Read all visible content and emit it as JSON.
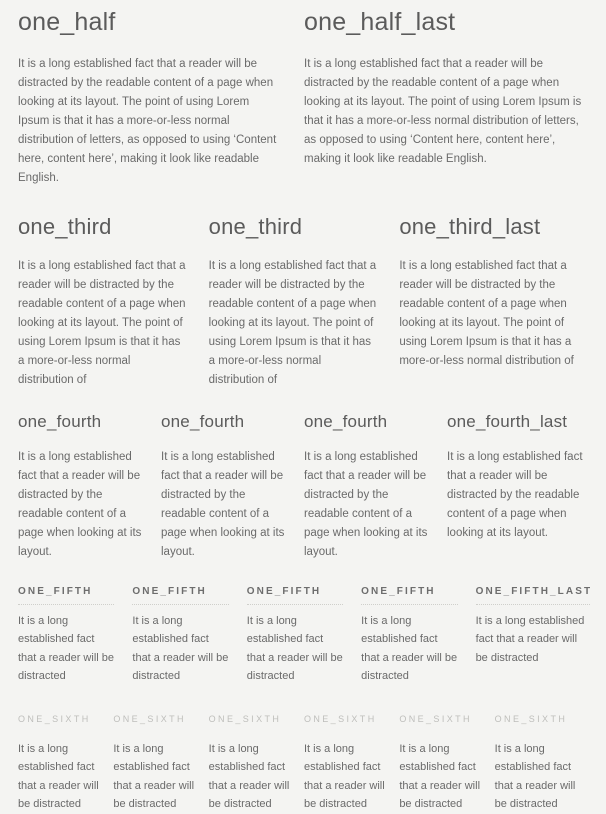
{
  "page": {
    "background_color": "#f4f4f2",
    "heading_color": "#5b5b5b",
    "body_text_color": "#6a6a6a",
    "muted_heading_color": "#bebebb",
    "divider_color": "#cfcfcb"
  },
  "rows": [
    {
      "name": "one_half",
      "columns": [
        {
          "heading": "one_half",
          "body": "It is a long established fact that a reader will be distracted by the readable content of a page when looking at its layout. The point of using Lorem Ipsum is that it has a more-or-less normal distribution of letters, as opposed to using ‘Content here, content here’, making it look like readable English."
        },
        {
          "heading": "one_half_last",
          "body": "It is a long established fact that a reader will be distracted by the readable content of a page when looking at its layout. The point of using Lorem Ipsum is that it has a more-or-less normal distribution of letters, as opposed to using ‘Content here, content here’, making it look like readable English."
        }
      ]
    },
    {
      "name": "one_third",
      "columns": [
        {
          "heading": "one_third",
          "body": "It is a long established fact that a reader will be distracted by the readable content of a page when looking at its layout. The point of using Lorem Ipsum is that it has a more-or-less normal distribution of"
        },
        {
          "heading": "one_third",
          "body": "It is a long established fact that a reader will be distracted by the readable content of a page when looking at its layout. The point of using Lorem Ipsum is that it has a more-or-less normal distribution of"
        },
        {
          "heading": "one_third_last",
          "body": "It is a long established fact that a reader will be distracted by the readable content of a page when looking at its layout. The point of using Lorem Ipsum is that it has a more-or-less normal distribution of"
        }
      ]
    },
    {
      "name": "one_fourth",
      "columns": [
        {
          "heading": "one_fourth",
          "body": "It is a long established fact that a reader will be distracted by the readable content of a page when looking at its layout."
        },
        {
          "heading": "one_fourth",
          "body": "It is a long established fact that a reader will be distracted by the readable content of a page when looking at its layout."
        },
        {
          "heading": "one_fourth",
          "body": "It is a long established fact that a reader will be distracted by the readable content of a page when looking at its layout."
        },
        {
          "heading": "one_fourth_last",
          "body": "It is a long established fact that a reader will be distracted by the readable content of a page when looking at its layout."
        }
      ]
    },
    {
      "name": "one_fifth",
      "columns": [
        {
          "heading": "ONE_FIFTH",
          "body": "It is a long established fact that a reader will be distracted"
        },
        {
          "heading": "ONE_FIFTH",
          "body": "It is a long established fact that a reader will be distracted"
        },
        {
          "heading": "ONE_FIFTH",
          "body": "It is a long established fact that a reader will be distracted"
        },
        {
          "heading": "ONE_FIFTH",
          "body": "It is a long established fact that a reader will be distracted"
        },
        {
          "heading": "ONE_FIFTH_LAST",
          "body": "It is a long established fact that a reader will be distracted"
        }
      ]
    },
    {
      "name": "one_sixth",
      "columns": [
        {
          "heading": "ONE_SIXTH",
          "body": "It is a long established fact that a reader will be distracted"
        },
        {
          "heading": "ONE_SIXTH",
          "body": "It is a long established fact that a reader will be distracted"
        },
        {
          "heading": "ONE_SIXTH",
          "body": "It is a long established fact that a reader will be distracted"
        },
        {
          "heading": "ONE_SIXTH",
          "body": "It is a long established fact that a reader will be distracted"
        },
        {
          "heading": "ONE_SIXTH",
          "body": "It is a long established fact that a reader will be distracted"
        },
        {
          "heading": "ONE_SIXTH",
          "body": "It is a long established fact that a reader will be distracted"
        }
      ]
    }
  ]
}
